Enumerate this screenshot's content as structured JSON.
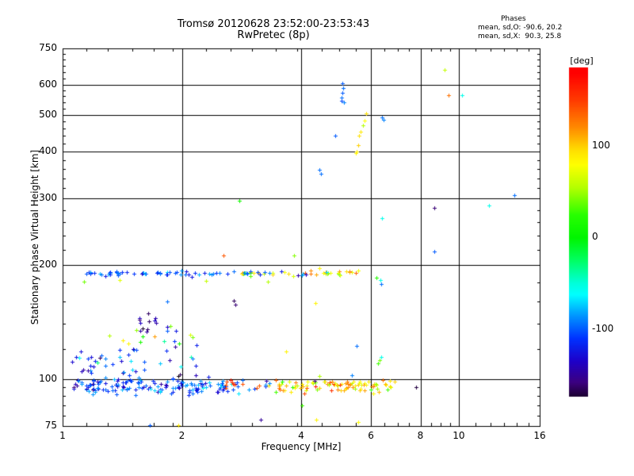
{
  "header": {
    "title_line1": "Tromsø 20120628 23:52:00-23:53:43",
    "title_line2": "RwPretec (8p)"
  },
  "phases_annotation": {
    "title": "Phases",
    "o_line": "mean, sd,O: -90.6, 20.2",
    "x_line": "mean, sd,X:  90.3, 25.8"
  },
  "chart_data": {
    "type": "scatter",
    "title": "Tromsø 20120628 23:52:00-23:53:43  RwPretec (8p)",
    "xlabel": "Frequency [MHz]",
    "ylabel": "Stationary phase Virtual Height [km]",
    "marker": "plus",
    "marker_size": 5,
    "x_axis": {
      "scale": "log",
      "min": 1,
      "max": 16,
      "major_ticks": [
        {
          "v": 1,
          "label": "1"
        },
        {
          "v": 2,
          "label": "2"
        },
        {
          "v": 4,
          "label": "4"
        },
        {
          "v": 6,
          "label": "6"
        },
        {
          "v": 8,
          "label": "8"
        },
        {
          "v": 10,
          "label": "10"
        },
        {
          "v": 16,
          "label": "16"
        }
      ],
      "minor_ticks": [
        1.15,
        1.3,
        1.5,
        1.7,
        1.9,
        2.3,
        2.65,
        3.0,
        3.45,
        3.9,
        4.5,
        5.0,
        5.5,
        6.5,
        7.0,
        7.5,
        8.5,
        9.0,
        9.5,
        11,
        12,
        13,
        14,
        15
      ],
      "grid_values": [
        2,
        4,
        6,
        8,
        10
      ]
    },
    "y_axis": {
      "scale": "log",
      "min": 75,
      "max": 750,
      "major_ticks": [
        {
          "v": 75,
          "label": "75"
        },
        {
          "v": 100,
          "label": "100"
        },
        {
          "v": 200,
          "label": "200"
        },
        {
          "v": 300,
          "label": "300"
        },
        {
          "v": 400,
          "label": "400"
        },
        {
          "v": 500,
          "label": "500"
        },
        {
          "v": 600,
          "label": "600"
        },
        {
          "v": 750,
          "label": "750"
        }
      ],
      "minor_ticks": [
        80,
        85,
        90,
        95,
        120,
        140,
        160,
        180,
        220,
        240,
        260,
        280,
        320,
        340,
        360,
        380,
        420,
        440,
        460,
        480,
        520,
        540,
        560,
        580,
        625,
        650,
        675,
        700,
        725
      ],
      "grid_values": [
        100,
        200,
        300,
        400,
        500,
        600
      ]
    },
    "colorbar": {
      "unit_label": "[deg]",
      "min": -180,
      "max": 180,
      "top_value": 186,
      "bottom_value": -174,
      "tick_values": [
        100,
        0,
        -100
      ],
      "colormap_stops": [
        [
          180,
          "#ff0000"
        ],
        [
          150,
          "#ff3c00"
        ],
        [
          120,
          "#ff8c00"
        ],
        [
          95,
          "#ffe100"
        ],
        [
          80,
          "#ffff00"
        ],
        [
          55,
          "#b4ff00"
        ],
        [
          25,
          "#28ff00"
        ],
        [
          0,
          "#00f500"
        ],
        [
          -25,
          "#00ff64"
        ],
        [
          -50,
          "#00ffdc"
        ],
        [
          -62,
          "#00ffff"
        ],
        [
          -85,
          "#0096ff"
        ],
        [
          -110,
          "#0032ff"
        ],
        [
          -135,
          "#1e00c8"
        ],
        [
          -158,
          "#3c0080"
        ],
        [
          -180,
          "#0f000f"
        ]
      ]
    },
    "clusters": [
      {
        "name": "e-band-o-mode",
        "n": 150,
        "f": [
          1.05,
          3.35
        ],
        "h": [
          95.5,
          2.2
        ],
        "h_clip": [
          88,
          101
        ],
        "phase": [
          -105,
          22
        ],
        "seed": 101
      },
      {
        "name": "e-band-x-mode",
        "n": 88,
        "f": [
          3.3,
          6.9
        ],
        "h": [
          96.0,
          2.0
        ],
        "h_clip": [
          89,
          102
        ],
        "phase": [
          85,
          30
        ],
        "seed": 102
      },
      {
        "name": "e-band-red",
        "n": 10,
        "f": [
          2.55,
          3.2
        ],
        "h": [
          96.0,
          1.6
        ],
        "h_clip": [
          90,
          101
        ],
        "phase": [
          150,
          12
        ],
        "seed": 103
      },
      {
        "name": "e-band-orange",
        "n": 8,
        "f": [
          4.3,
          5.3
        ],
        "h": [
          96.5,
          1.6
        ],
        "h_clip": [
          90,
          101
        ],
        "phase": [
          142,
          14
        ],
        "seed": 104
      },
      {
        "name": "sporadic-above-band",
        "n": 45,
        "f": [
          1.05,
          1.65
        ],
        "h": [
          108,
          7
        ],
        "h_clip": [
          99,
          126
        ],
        "phase": [
          -112,
          26
        ],
        "seed": 105
      },
      {
        "name": "sporadic-above-2",
        "n": 16,
        "f": [
          1.68,
          2.5
        ],
        "h": [
          112,
          10
        ],
        "h_clip": [
          99,
          134
        ],
        "phase": [
          -115,
          38
        ],
        "seed": 106
      },
      {
        "name": "mid-dark-purple",
        "n": 13,
        "f": [
          1.55,
          1.85
        ],
        "h": [
          140,
          6
        ],
        "h_clip": [
          128,
          152
        ],
        "phase": [
          -150,
          14
        ],
        "seed": 107
      },
      {
        "name": "mid-mixed",
        "n": 12,
        "f": [
          1.25,
          2.2
        ],
        "h": [
          130,
          5
        ],
        "h_clip": [
          120,
          142
        ],
        "phase": [
          40,
          55
        ],
        "seed": 108
      },
      {
        "name": "f-band-o-mode",
        "n": 55,
        "f": [
          1.08,
          2.78
        ],
        "h": [
          190.5,
          1.4
        ],
        "h_clip": [
          186,
          195
        ],
        "phase": [
          -100,
          15
        ],
        "seed": 109
      },
      {
        "name": "f-band-x-mode",
        "n": 36,
        "f": [
          2.78,
          5.6
        ],
        "h": [
          190.5,
          1.7
        ],
        "h_clip": [
          185,
          196
        ],
        "phase": [
          90,
          38
        ],
        "seed": 110
      },
      {
        "name": "f-band-mixed-blue",
        "n": 14,
        "f": [
          2.78,
          4.65
        ],
        "h": [
          190.5,
          1.4
        ],
        "h_clip": [
          186,
          195
        ],
        "phase": [
          -95,
          22
        ],
        "seed": 111
      }
    ],
    "points": [
      [
        5.08,
        606,
        -100
      ],
      [
        5.1,
        589,
        -95
      ],
      [
        5.09,
        573,
        -100
      ],
      [
        5.07,
        556,
        -95
      ],
      [
        5.06,
        546,
        -105
      ],
      [
        5.12,
        540,
        -90
      ],
      [
        5.84,
        505,
        95
      ],
      [
        5.78,
        483,
        80
      ],
      [
        5.74,
        470,
        55
      ],
      [
        5.66,
        452,
        90
      ],
      [
        5.6,
        440,
        95
      ],
      [
        5.57,
        415,
        100
      ],
      [
        5.52,
        400,
        90
      ],
      [
        5.49,
        396,
        85
      ],
      [
        6.41,
        492,
        -95
      ],
      [
        6.47,
        485,
        -90
      ],
      [
        9.21,
        657,
        60
      ],
      [
        9.44,
        563,
        130
      ],
      [
        10.2,
        563,
        -55
      ],
      [
        8.67,
        284,
        -160
      ],
      [
        8.67,
        217,
        -100
      ],
      [
        11.9,
        288,
        -55
      ],
      [
        13.8,
        306,
        -95
      ],
      [
        6.41,
        266,
        -55
      ],
      [
        4.88,
        440,
        -100
      ],
      [
        4.45,
        358,
        -95
      ],
      [
        4.49,
        349,
        -95
      ],
      [
        2.79,
        296,
        10
      ],
      [
        2.55,
        212,
        140
      ],
      [
        3.84,
        212,
        45
      ],
      [
        4.45,
        196,
        85
      ],
      [
        4.35,
        159,
        85
      ],
      [
        1.84,
        160,
        -95
      ],
      [
        2.71,
        161,
        -165
      ],
      [
        2.73,
        157,
        -160
      ],
      [
        1.84,
        134,
        -100
      ],
      [
        6.2,
        185,
        20
      ],
      [
        6.35,
        183,
        -55
      ],
      [
        6.37,
        178,
        -95
      ],
      [
        6.26,
        110,
        30
      ],
      [
        6.32,
        112,
        40
      ],
      [
        6.38,
        114,
        -55
      ],
      [
        5.53,
        122,
        -95
      ],
      [
        3.67,
        118,
        85
      ],
      [
        7.81,
        95,
        -170
      ],
      [
        5.36,
        102,
        -90
      ],
      [
        4.33,
        99,
        -160
      ],
      [
        4.02,
        85,
        30
      ],
      [
        4.37,
        78,
        85
      ],
      [
        5.58,
        77,
        80
      ],
      [
        3.16,
        78,
        -150
      ],
      [
        1.66,
        75.3,
        -100
      ],
      [
        1.96,
        75.5,
        90
      ],
      [
        1.13,
        181,
        40
      ],
      [
        1.39,
        183,
        70
      ],
      [
        2.3,
        182,
        60
      ],
      [
        3.3,
        181,
        55
      ]
    ]
  }
}
